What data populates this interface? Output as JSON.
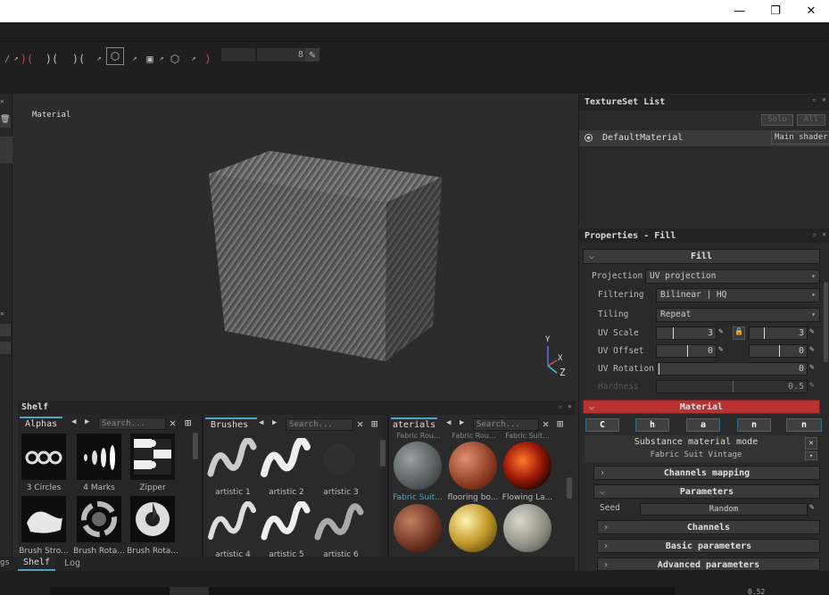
{
  "window": {
    "min": "—",
    "max": "❐",
    "close": "✕"
  },
  "toolbar": {
    "field_value": "8"
  },
  "viewport": {
    "label": "Material",
    "axis_y": "Y",
    "axis_x": "X",
    "axis_z": "Z"
  },
  "textureset": {
    "title": "TextureSet List",
    "btn_solo": "Solo",
    "btn_all": "All",
    "item": "DefaultMaterial",
    "shader": "Main shader"
  },
  "properties": {
    "title": "Properties - Fill",
    "fill_header": "Fill",
    "projection_label": "Projection",
    "projection_value": "UV projection",
    "filtering_label": "Filtering",
    "filtering_value": "Bilinear | HQ",
    "tiling_label": "Tiling",
    "tiling_value": "Repeat",
    "uvscale_label": "UV Scale",
    "uvscale_a": "3",
    "uvscale_b": "3",
    "uvoffset_label": "UV Offset",
    "uvoffset_a": "0",
    "uvoffset_b": "0",
    "uvrotation_label": "UV Rotation",
    "uvrotation_value": "0",
    "hardness_label": "Hardness",
    "hardness_value": "0.5",
    "material_header": "Material",
    "channels": "Channels",
    "substance_mode": "Substance material mode",
    "substance_name": "Fabric Suit Vintage",
    "channels_mapping": "Channels mapping",
    "parameters": "Parameters",
    "seed_label": "Seed",
    "seed_value": "Random",
    "basic_parameters": "Basic parameters",
    "advanced_parameters": "Advanced parameters"
  },
  "shelf": {
    "title": "Shelf",
    "alphas_tab": "Alphas",
    "brushes_tab": "Brushes",
    "materials_tab": "aterials",
    "search_placeholder": "Search...",
    "alphas": [
      "3 Circles",
      "4 Marks",
      "Zipper",
      "Brush Stro...",
      "Brush Rota...",
      "Brush Rota..."
    ],
    "brushes": [
      "artistic 1",
      "artistic 2",
      "artistic 3",
      "artistic 4",
      "artistic 5",
      "artistic 6"
    ],
    "materials_top": [
      "Fabric Rou...",
      "Fabric Rou...",
      "Fabric Suit..."
    ],
    "materials": [
      "Fabric Suit...",
      "flooring bo...",
      "Flowing La..."
    ]
  },
  "bottom_tabs": {
    "partial": "gs",
    "shelf": "Shelf",
    "log": "Log"
  },
  "status": {
    "value": "0.52"
  },
  "colors": {
    "accent_blue": "#4ea3c7",
    "material_red": "#b83232"
  }
}
